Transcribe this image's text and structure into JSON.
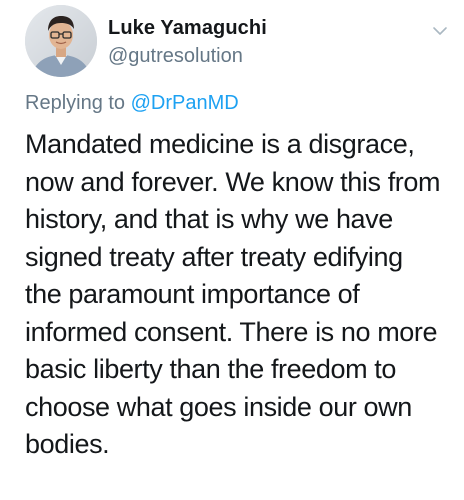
{
  "author": {
    "display_name": "Luke Yamaguchi",
    "handle": "@gutresolution",
    "avatar_icon": "profile-photo"
  },
  "reply": {
    "prefix": "Replying to",
    "mention": "@DrPanMD"
  },
  "tweet": {
    "lines": [
      "Mandated medicine is a disgrace,",
      "now and forever. We know this from",
      "history, and that is why we have",
      "signed treaty after treaty edifying",
      "the paramount importance of",
      "informed consent. There is no more",
      "basic liberty than the freedom to",
      "choose what goes inside our own",
      "bodies."
    ]
  },
  "menu": {
    "icon": "chevron-down-icon"
  },
  "colors": {
    "text": "#14171a",
    "secondary": "#657786",
    "link": "#1da1f2"
  }
}
